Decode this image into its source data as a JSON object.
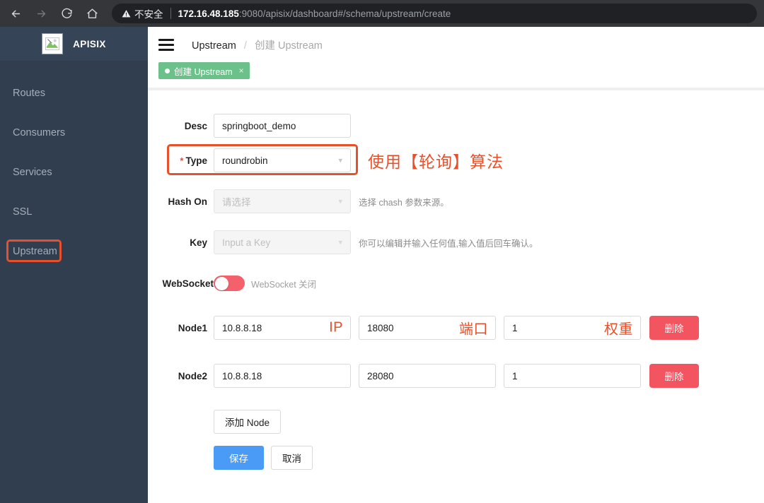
{
  "browser": {
    "back_icon": "arrow-left-icon",
    "forward_icon": "arrow-right-icon",
    "reload_icon": "reload-icon",
    "home_icon": "home-icon",
    "security_icon": "warning-triangle-icon",
    "security_text": "不安全",
    "url_host": "172.16.48.185",
    "url_rest": ":9080/apisix/dashboard#/schema/upstream/create"
  },
  "sidebar": {
    "logo_icon": "broken-image-icon",
    "brand": "APISIX",
    "items": [
      {
        "label": "Routes"
      },
      {
        "label": "Consumers"
      },
      {
        "label": "Services"
      },
      {
        "label": "SSL"
      },
      {
        "label": "Upstream",
        "annotated": true
      }
    ]
  },
  "header": {
    "menu_icon": "hamburger-menu-icon",
    "breadcrumb_current": "Upstream",
    "breadcrumb_sep": "/",
    "breadcrumb_sub": "创建 Upstream"
  },
  "tab": {
    "label": "创建 Upstream",
    "close": "×"
  },
  "form": {
    "desc": {
      "label": "Desc",
      "value": "springboot_demo"
    },
    "type": {
      "label": "Type",
      "required_mark": "*",
      "value": "roundrobin",
      "annotation": "使用【轮询】算法"
    },
    "hash_on": {
      "label": "Hash On",
      "placeholder": "请选择",
      "hint": "选择 chash 参数来源。"
    },
    "key": {
      "label": "Key",
      "placeholder": "Input a Key",
      "hint": "你可以编辑并输入任何值,输入值后回车确认。"
    },
    "websocket": {
      "label": "WebSocket",
      "state_text": "WebSocket 关闭",
      "enabled": false
    },
    "node_annotations": {
      "ip": "IP",
      "port": "端口",
      "weight": "权重"
    },
    "nodes": [
      {
        "label": "Node1",
        "host": "10.8.8.18",
        "port": "18080",
        "weight": "1",
        "delete_label": "删除",
        "annotated": true
      },
      {
        "label": "Node2",
        "host": "10.8.8.18",
        "port": "28080",
        "weight": "1",
        "delete_label": "删除",
        "annotated": false
      }
    ],
    "add_node_label": "添加 Node",
    "save_label": "保存",
    "cancel_label": "取消"
  },
  "colors": {
    "annotation_red": "#e6502a",
    "sidebar_bg": "#303e4f",
    "tab_green": "#6cc18a",
    "delete_red": "#f25560",
    "primary_blue": "#4a9bf5",
    "switch_off_red": "#f4606c"
  }
}
